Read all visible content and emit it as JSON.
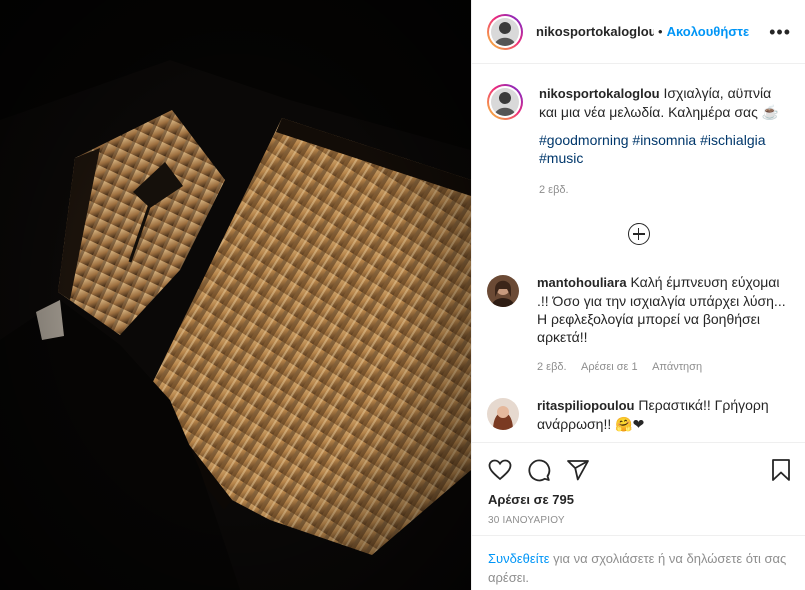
{
  "post": {
    "username": "nikosportokaloglou",
    "dot": "•",
    "follow_label": "Ακολουθήστε",
    "more_label": "•••",
    "caption": {
      "username": "nikosportokaloglou",
      "text": "Ισχιαλγία, αϋπνία και μια νέα μελωδία. Καλημέρα σας",
      "emoji": "☕",
      "hashtags": [
        "#goodmorning",
        "#insomnia",
        "#ischialgia",
        "#music"
      ],
      "time": "2 εβδ."
    },
    "comments": [
      {
        "username": "mantohouliara",
        "text": "Καλή έμπνευση εύχομαι .!! Όσο για την ισχιαλγία υπάρχει λύση... Η ρεφλεξολογία μπορεί να βοηθήσει αρκετά!!",
        "time": "2 εβδ.",
        "likes": "Αρέσει σε 1",
        "reply": "Απάντηση"
      },
      {
        "username": "ritaspiliopoulou",
        "text": "Περαστικά!! Γρήγορη ανάρρωση!!",
        "emoji": "🤗❤"
      }
    ],
    "likes_label": "Αρέσει σε 795",
    "date": "30 ΙΑΝΟΥΑΡΙΟΥ",
    "login": {
      "link": "Συνδεθείτε",
      "text": " για να σχολιάσετε ή να δηλώσετε ότι σας αρέσει."
    }
  },
  "icons": {
    "like": "heart-icon",
    "comment": "comment-icon",
    "share": "share-icon",
    "save": "bookmark-icon",
    "load_more": "plus-circle-icon"
  },
  "colors": {
    "link_blue": "#0095f6",
    "hashtag": "#00376b",
    "muted": "#8e8e8e"
  }
}
